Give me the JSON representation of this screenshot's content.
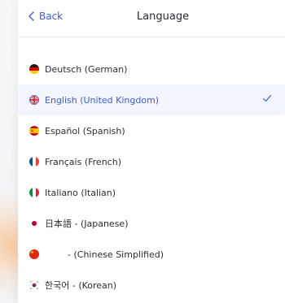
{
  "header": {
    "back_label": "Back",
    "title": "Language"
  },
  "languages": [
    {
      "label": "Deutsch (German)",
      "flag": "germany-flag-icon",
      "selected": false
    },
    {
      "label": "English (United Kingdom)",
      "flag": "uk-flag-icon",
      "selected": true
    },
    {
      "label": "Español (Spanish)",
      "flag": "spain-flag-icon",
      "selected": false
    },
    {
      "label": "Français (French)",
      "flag": "france-flag-icon",
      "selected": false
    },
    {
      "label": "Italiano (Italian)",
      "flag": "italy-flag-icon",
      "selected": false
    },
    {
      "label": "日本語 - (Japanese)",
      "flag": "japan-flag-icon",
      "selected": false
    },
    {
      "label": "- (Chinese Simplified)",
      "flag": "china-flag-icon",
      "selected": false
    },
    {
      "label": "한국어 - (Korean)",
      "flag": "korea-flag-icon",
      "selected": false
    }
  ],
  "colors": {
    "accent": "#3d5cdb",
    "selected_bg": "#f3f5ff"
  }
}
